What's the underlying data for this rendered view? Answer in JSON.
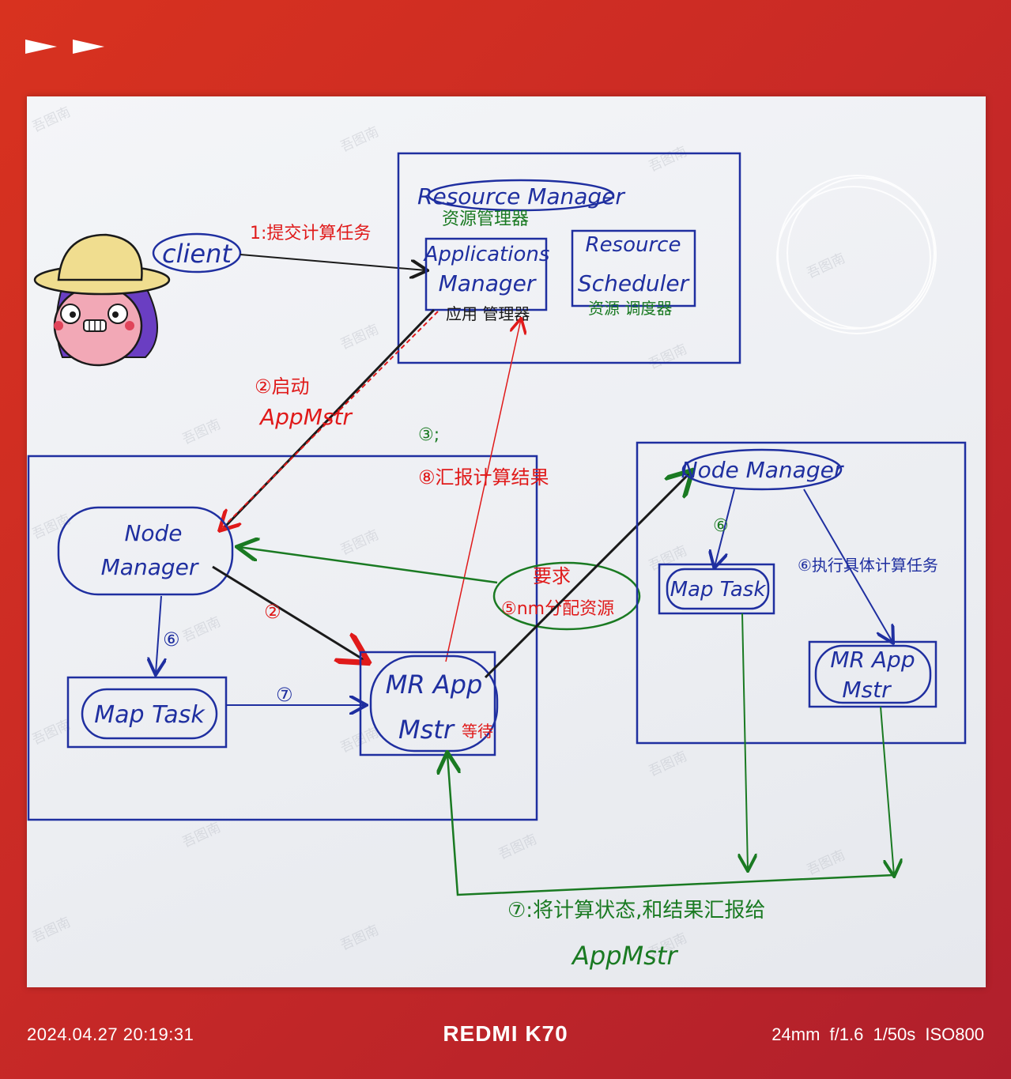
{
  "header": {
    "icons": [
      "play-icon",
      "play-icon"
    ]
  },
  "diagram": {
    "client": "client",
    "step1": "1:提交计算任务",
    "resource_manager": "Resource Manager",
    "resource_manager_cn": "资源管理器",
    "applications_manager_line1": "Applications",
    "applications_manager_line2": "Manager",
    "applications_manager_cn": "应用 管理器",
    "resource_scheduler_line1": "Resource",
    "resource_scheduler_line2": "Scheduler",
    "resource_scheduler_cn": "资源 调度器",
    "step2_label": "②启动",
    "step2_target": "AppMstr",
    "step3": "③;",
    "step8": "⑧汇报计算结果",
    "left_node_manager_line1": "Node",
    "left_node_manager_line2": "Manager",
    "step2_small": "②",
    "left_step6": "⑥",
    "left_map_task": "Map Task",
    "step7_small": "⑦",
    "mr_app_line1": "MR App",
    "mr_app_line2": "Mstr",
    "mr_app_cn": "等待",
    "request_line1": "要求",
    "request_line2": "⑤nm分配资源",
    "right_node_manager": "Node Manager",
    "right_step6": "⑥",
    "right_map_task": "Map Task",
    "right_step6_text": "⑥执行具体计算任务",
    "right_mr_app_line1": "MR App",
    "right_mr_app_line2": "Mstr",
    "step7_text": "⑦:将计算状态,和结果汇报给",
    "step7_target": "AppMstr",
    "watermark": "吾图南"
  },
  "colors": {
    "blue": "#1f2fa0",
    "red": "#e01a1a",
    "green": "#1a7a22",
    "black": "#1a1a1a"
  },
  "footer": {
    "datetime": "2024.04.27  20:19:31",
    "device": "REDMI K70",
    "exif": "24mm  f/1.6  1/50s  ISO800"
  }
}
